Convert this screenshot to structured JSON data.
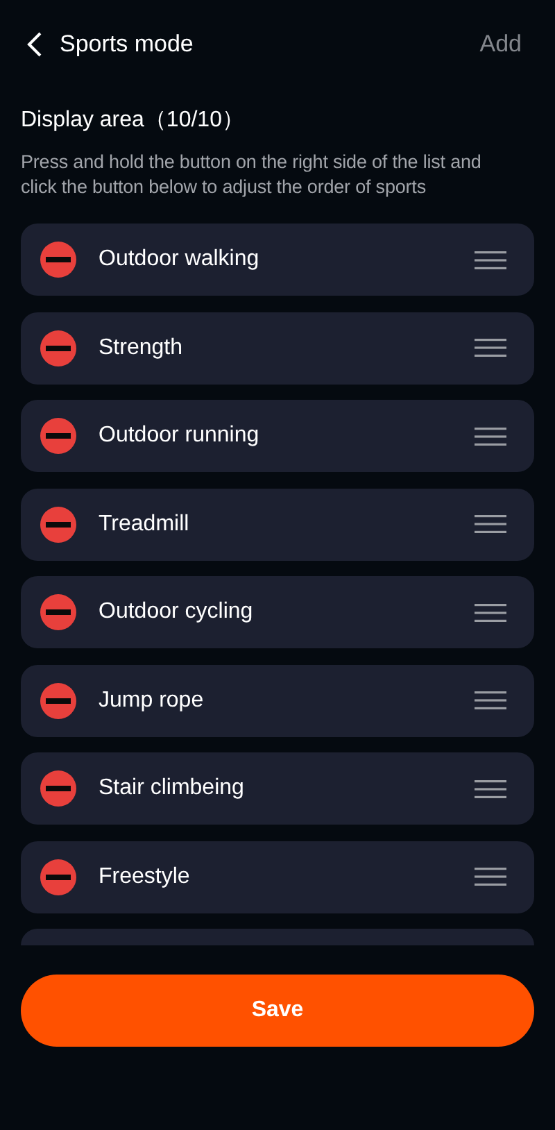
{
  "header": {
    "title": "Sports mode",
    "action": "Add"
  },
  "section": {
    "title": "Display area（10/10）",
    "description": "Press and hold the button on the right side of the list and click the button below to adjust the order of sports"
  },
  "sports": [
    {
      "name": "Outdoor walking"
    },
    {
      "name": "Strength"
    },
    {
      "name": "Outdoor running"
    },
    {
      "name": "Treadmill"
    },
    {
      "name": "Outdoor cycling"
    },
    {
      "name": "Jump rope"
    },
    {
      "name": "Stair climbeing"
    },
    {
      "name": "Freestyle"
    }
  ],
  "save_button": "Save"
}
